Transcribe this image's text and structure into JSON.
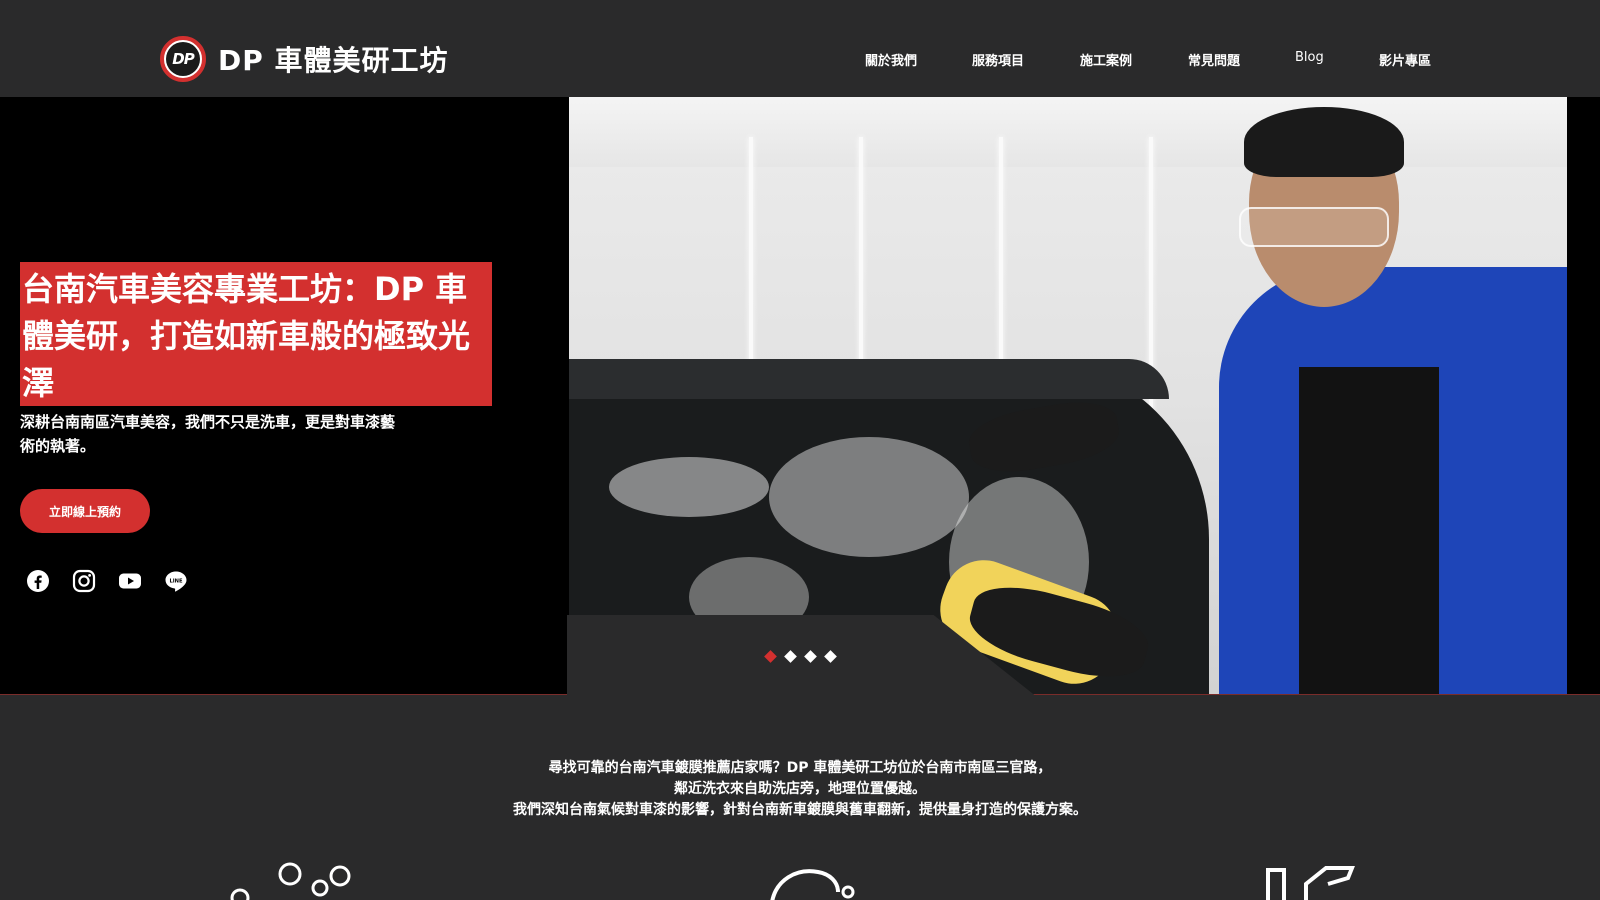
{
  "brand": {
    "logo_mark": "DP",
    "name": "DP 車體美研工坊",
    "accent_color": "#d3302f"
  },
  "nav": {
    "items": [
      {
        "label": "關於我們"
      },
      {
        "label": "服務項目"
      },
      {
        "label": "施工案例"
      },
      {
        "label": "常見問題"
      },
      {
        "label": "Blog"
      },
      {
        "label": "影片專區"
      }
    ]
  },
  "hero": {
    "headline": "台南汽車美容專業工坊：DP 車體美研，打造如新車般的極致光澤",
    "subtext": "深耕台南南區汽車美容，我們不只是洗車，更是對車漆藝術的執著。",
    "cta_label": "立即線上預約",
    "social": [
      {
        "icon": "facebook-icon"
      },
      {
        "icon": "instagram-icon"
      },
      {
        "icon": "youtube-icon"
      },
      {
        "icon": "line-icon"
      }
    ],
    "slider": {
      "total": 4,
      "active": 1
    }
  },
  "intro": {
    "lines": [
      "尋找可靠的台南汽車鍍膜推薦店家嗎？DP 車體美研工坊位於台南市南區三官路，",
      "鄰近洗衣來自助洗店旁，地理位置優越。",
      "我們深知台南氣候對車漆的影響，針對台南新車鍍膜與舊車翻新，提供量身打造的保護方案。"
    ]
  },
  "features": [
    {
      "icon": "bubbles-icon"
    },
    {
      "icon": "car-wash-icon"
    },
    {
      "icon": "spray-bottle-icon"
    }
  ]
}
